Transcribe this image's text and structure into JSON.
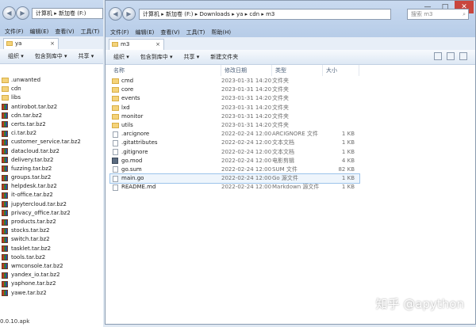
{
  "back_window": {
    "breadcrumb": [
      "计算机",
      "新加卷 (F:)"
    ],
    "menu": [
      "文件(F)",
      "编辑(E)",
      "查看(V)",
      "工具(T)"
    ],
    "tab_label": "ya",
    "toolbar": [
      "组织",
      "包含到库中",
      "共享"
    ],
    "files": [
      {
        "name": ".unwanted",
        "kind": "folder"
      },
      {
        "name": "cdn",
        "kind": "folder"
      },
      {
        "name": "libs",
        "kind": "folder"
      },
      {
        "name": "antirobot.tar.bz2",
        "kind": "archive"
      },
      {
        "name": "cdn.tar.bz2",
        "kind": "archive"
      },
      {
        "name": "certs.tar.bz2",
        "kind": "archive"
      },
      {
        "name": "ci.tar.bz2",
        "kind": "archive"
      },
      {
        "name": "customer_service.tar.bz2",
        "kind": "archive"
      },
      {
        "name": "datacloud.tar.bz2",
        "kind": "archive"
      },
      {
        "name": "delivery.tar.bz2",
        "kind": "archive"
      },
      {
        "name": "fuzzing.tar.bz2",
        "kind": "archive"
      },
      {
        "name": "groups.tar.bz2",
        "kind": "archive"
      },
      {
        "name": "helpdesk.tar.bz2",
        "kind": "archive"
      },
      {
        "name": "it-office.tar.bz2",
        "kind": "archive"
      },
      {
        "name": "jupytercloud.tar.bz2",
        "kind": "archive"
      },
      {
        "name": "privacy_office.tar.bz2",
        "kind": "archive"
      },
      {
        "name": "products.tar.bz2",
        "kind": "archive"
      },
      {
        "name": "stocks.tar.bz2",
        "kind": "archive"
      },
      {
        "name": "switch.tar.bz2",
        "kind": "archive"
      },
      {
        "name": "tasklet.tar.bz2",
        "kind": "archive"
      },
      {
        "name": "tools.tar.bz2",
        "kind": "archive"
      },
      {
        "name": "wmconsole.tar.bz2",
        "kind": "archive"
      },
      {
        "name": "yandex_io.tar.bz2",
        "kind": "archive"
      },
      {
        "name": "yaphone.tar.bz2",
        "kind": "archive"
      },
      {
        "name": "yawe.tar.bz2",
        "kind": "archive"
      }
    ],
    "status_text": "0.0.10.apk"
  },
  "front_window": {
    "breadcrumb": [
      "计算机",
      "新加卷 (F:)",
      "Downloads",
      "ya",
      "cdn",
      "m3"
    ],
    "search_placeholder": "搜索 m3",
    "menu": [
      "文件(F)",
      "编辑(E)",
      "查看(V)",
      "工具(T)",
      "帮助(H)"
    ],
    "tab_label": "m3",
    "toolbar": [
      "组织",
      "包含到库中",
      "共享",
      "新建文件夹"
    ],
    "columns": {
      "name": "名称",
      "date": "修改日期",
      "type": "类型",
      "size": "大小"
    },
    "files": [
      {
        "name": "cmd",
        "date": "2023-01-31 14:20",
        "type": "文件夹",
        "size": "",
        "kind": "folder"
      },
      {
        "name": "core",
        "date": "2023-01-31 14:20",
        "type": "文件夹",
        "size": "",
        "kind": "folder"
      },
      {
        "name": "events",
        "date": "2023-01-31 14:20",
        "type": "文件夹",
        "size": "",
        "kind": "folder"
      },
      {
        "name": "lxd",
        "date": "2023-01-31 14:20",
        "type": "文件夹",
        "size": "",
        "kind": "folder"
      },
      {
        "name": "monitor",
        "date": "2023-01-31 14:20",
        "type": "文件夹",
        "size": "",
        "kind": "folder"
      },
      {
        "name": "utils",
        "date": "2023-01-31 14:20",
        "type": "文件夹",
        "size": "",
        "kind": "folder"
      },
      {
        "name": ".arcignore",
        "date": "2022-02-24 12:00",
        "type": "ARCIGNORE 文件",
        "size": "1 KB",
        "kind": "file"
      },
      {
        "name": ".gitattributes",
        "date": "2022-02-24 12:00",
        "type": "文本文档",
        "size": "1 KB",
        "kind": "file"
      },
      {
        "name": ".gitignore",
        "date": "2022-02-24 12:00",
        "type": "文本文档",
        "size": "1 KB",
        "kind": "file"
      },
      {
        "name": "go.mod",
        "date": "2022-02-24 12:00",
        "type": "电影剪辑",
        "size": "4 KB",
        "kind": "gomod"
      },
      {
        "name": "go.sum",
        "date": "2022-02-24 12:00",
        "type": "SUM 文件",
        "size": "82 KB",
        "kind": "file"
      },
      {
        "name": "main.go",
        "date": "2022-02-24 12:00",
        "type": "Go 源文件",
        "size": "1 KB",
        "kind": "file",
        "selected": true
      },
      {
        "name": "README.md",
        "date": "2022-02-24 12:00",
        "type": "Markdown 源文件",
        "size": "1 KB",
        "kind": "file"
      }
    ],
    "window_controls": [
      "—",
      "□",
      "✕"
    ]
  },
  "watermark": "知乎 @apython"
}
